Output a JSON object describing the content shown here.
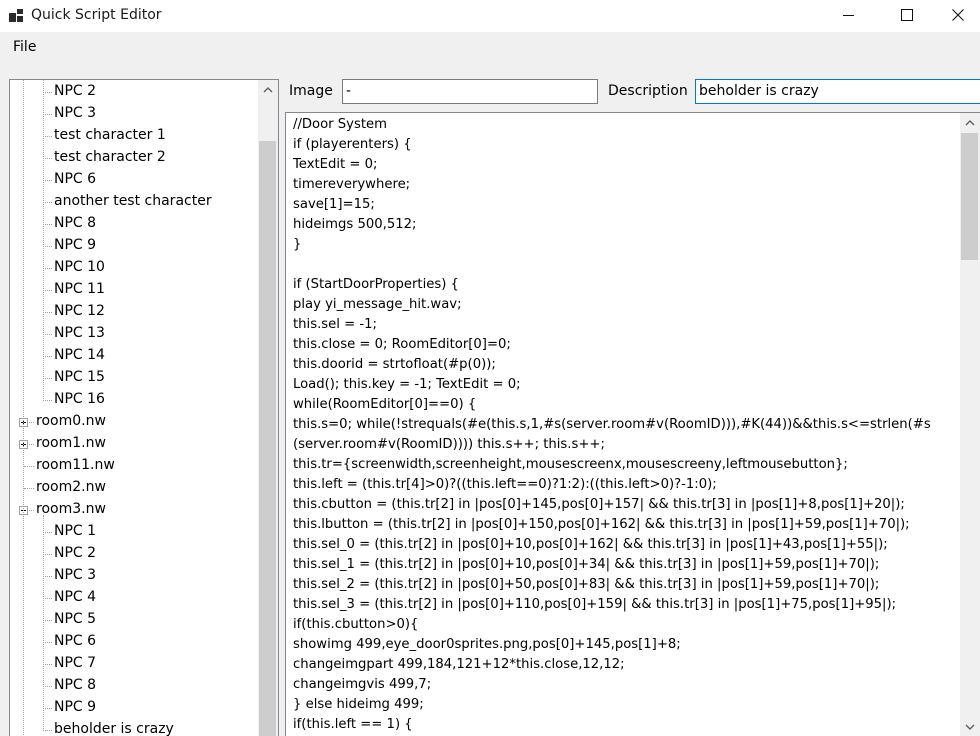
{
  "window": {
    "title": "Quick Script Editor",
    "icons": [
      "app-icon",
      "minimize-icon",
      "maximize-icon",
      "close-icon"
    ]
  },
  "menu": {
    "file": "File"
  },
  "tree": {
    "items": [
      {
        "label": "NPC 2",
        "level": 1
      },
      {
        "label": "NPC 3",
        "level": 1
      },
      {
        "label": "test character 1",
        "level": 1
      },
      {
        "label": "test character 2",
        "level": 1
      },
      {
        "label": "NPC 6",
        "level": 1
      },
      {
        "label": "another test character",
        "level": 1
      },
      {
        "label": "NPC 8",
        "level": 1
      },
      {
        "label": "NPC 9",
        "level": 1
      },
      {
        "label": "NPC 10",
        "level": 1
      },
      {
        "label": "NPC 11",
        "level": 1
      },
      {
        "label": "NPC 12",
        "level": 1
      },
      {
        "label": "NPC 13",
        "level": 1
      },
      {
        "label": "NPC 14",
        "level": 1
      },
      {
        "label": "NPC 15",
        "level": 1
      },
      {
        "label": "NPC 16",
        "level": 1
      },
      {
        "label": "room0.nw",
        "level": 0,
        "expander": "collapsed"
      },
      {
        "label": "room1.nw",
        "level": 0,
        "expander": "collapsed"
      },
      {
        "label": "room11.nw",
        "level": 0
      },
      {
        "label": "room2.nw",
        "level": 0
      },
      {
        "label": "room3.nw",
        "level": 0,
        "expander": "expanded"
      },
      {
        "label": "NPC 1",
        "level": 1
      },
      {
        "label": "NPC 2",
        "level": 1
      },
      {
        "label": "NPC 3",
        "level": 1
      },
      {
        "label": "NPC 4",
        "level": 1
      },
      {
        "label": "NPC 5",
        "level": 1
      },
      {
        "label": "NPC 6",
        "level": 1
      },
      {
        "label": "NPC 7",
        "level": 1
      },
      {
        "label": "NPC 8",
        "level": 1
      },
      {
        "label": "NPC 9",
        "level": 1
      },
      {
        "label": "beholder is crazy",
        "level": 1
      }
    ],
    "scroll_position": 0.1
  },
  "fields": {
    "image_label": "Image",
    "image_value": "-",
    "description_label": "Description",
    "description_value": "beholder is crazy"
  },
  "code": {
    "lines": [
      "//Door System",
      "if (playerenters) {",
      "TextEdit = 0;",
      "timereverywhere;",
      "save[1]=15;",
      "hideimgs 500,512;",
      "}",
      "",
      "if (StartDoorProperties) {",
      "play yi_message_hit.wav;",
      "this.sel = -1;",
      "this.close = 0; RoomEditor[0]=0;",
      "this.doorid = strtofloat(#p(0));",
      "Load(); this.key = -1; TextEdit = 0;",
      "while(RoomEditor[0]==0) {",
      "this.s=0; while(!strequals(#e(this.s,1,#s(server.room#v(RoomID))),#K(44))&&this.s<=strlen(#s",
      "(server.room#v(RoomID)))) this.s++; this.s++;",
      "this.tr={screenwidth,screenheight,mousescreenx,mousescreeny,leftmousebutton};",
      "this.left = (this.tr[4]>0)?((this.left==0)?1:2):((this.left>0)?-1:0);",
      "this.cbutton = (this.tr[2] in |pos[0]+145,pos[0]+157| && this.tr[3] in |pos[1]+8,pos[1]+20|);",
      "this.lbutton = (this.tr[2] in |pos[0]+150,pos[0]+162| && this.tr[3] in |pos[1]+59,pos[1]+70|);",
      "this.sel_0 = (this.tr[2] in |pos[0]+10,pos[0]+162| && this.tr[3] in |pos[1]+43,pos[1]+55|);",
      "this.sel_1 = (this.tr[2] in |pos[0]+10,pos[0]+34| && this.tr[3] in |pos[1]+59,pos[1]+70|);",
      "this.sel_2 = (this.tr[2] in |pos[0]+50,pos[0]+83| && this.tr[3] in |pos[1]+59,pos[1]+70|);",
      "this.sel_3 = (this.tr[2] in |pos[0]+110,pos[0]+159| && this.tr[3] in |pos[1]+75,pos[1]+95|);",
      "if(this.cbutton>0){",
      "showimg 499,eye_door0sprites.png,pos[0]+145,pos[1]+8;",
      "changeimgpart 499,184,121+12*this.close,12,12;",
      "changeimgvis 499,7;",
      "} else hideimg 499;",
      "if(this.left == 1) {"
    ],
    "scroll_position": 0.05
  },
  "colors": {
    "window_bg": "#f0f0f0",
    "focus_border": "#0078d7",
    "scroll_thumb": "#cdcdcd"
  }
}
